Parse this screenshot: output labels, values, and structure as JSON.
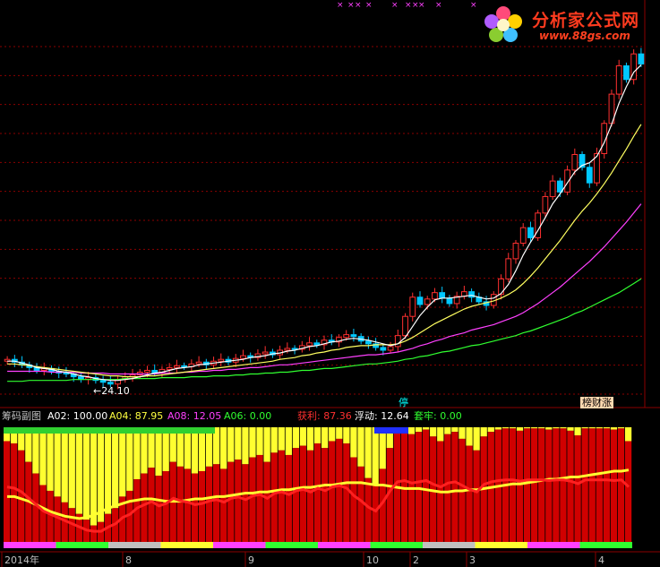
{
  "logo": {
    "title": "分析家公式网",
    "url": "www.88gs.com"
  },
  "tags": {
    "stop": "停",
    "rank": "榜财涨"
  },
  "price_low_label": "←24.10",
  "indicator": {
    "name": "筹码副图",
    "a02": "A02: 100.00",
    "a04": "A04: 87.95",
    "a08": "A08: 12.05",
    "a06": "A06: 0.00",
    "profit": "获利: 87.36",
    "float": "浮动: 12.64",
    "trapped": "套牢: 0.00"
  },
  "time_axis": [
    "2014年",
    "8",
    "9",
    "10",
    "2",
    "3",
    "4"
  ],
  "colors": {
    "background": "#000000",
    "grid": "#8b0000",
    "up": "#ff3030",
    "down": "#00c8ff",
    "ma_short": "#ffffff",
    "ma_mid": "#ffff60",
    "ma_long": "#ff40ff",
    "ma_longest": "#30ff30",
    "profit_bar": "#ffff30",
    "trapped_bar": "#d00000"
  },
  "chart_data": [
    {
      "type": "candlestick",
      "title": "",
      "low_marker": 24.1,
      "close": [
        26.8,
        26.5,
        26.2,
        25.9,
        25.6,
        25.8,
        25.5,
        25.3,
        25.2,
        24.9,
        24.6,
        24.8,
        24.5,
        24.3,
        24.1,
        24.6,
        24.9,
        25.1,
        25.4,
        25.6,
        25.3,
        25.7,
        25.9,
        26.1,
        26.0,
        26.3,
        26.5,
        26.2,
        26.6,
        26.8,
        26.5,
        26.9,
        27.2,
        27.0,
        27.4,
        27.6,
        27.3,
        27.8,
        28.0,
        27.9,
        28.3,
        28.6,
        28.4,
        28.9,
        28.7,
        29.2,
        29.5,
        29.3,
        28.8,
        28.5,
        28.1,
        27.8,
        28.2,
        29.4,
        31.5,
        33.6,
        32.8,
        33.4,
        34.1,
        33.5,
        32.9,
        33.7,
        34.2,
        33.6,
        33.1,
        32.7,
        33.9,
        35.6,
        37.8,
        39.5,
        41.2,
        40.1,
        42.8,
        44.6,
        46.3,
        45.1,
        47.5,
        49.2,
        47.8,
        46.1,
        49.3,
        52.6,
        55.8,
        58.9,
        57.4,
        60.2,
        59.1
      ],
      "ma_short": [
        26.6,
        26.6,
        26.4,
        26.2,
        25.9,
        25.8,
        25.7,
        25.5,
        25.4,
        25.2,
        25.0,
        24.9,
        24.7,
        24.6,
        24.5,
        24.5,
        24.6,
        24.7,
        24.9,
        25.1,
        25.3,
        25.4,
        25.6,
        25.8,
        25.9,
        26.0,
        26.2,
        26.3,
        26.4,
        26.5,
        26.6,
        26.7,
        26.8,
        27.0,
        27.1,
        27.2,
        27.4,
        27.5,
        27.7,
        27.8,
        28.0,
        28.2,
        28.3,
        28.5,
        28.7,
        28.8,
        29.0,
        29.1,
        29.0,
        28.9,
        28.7,
        28.5,
        28.3,
        28.5,
        29.2,
        30.4,
        31.6,
        32.5,
        33.3,
        33.5,
        33.5,
        33.6,
        33.7,
        33.8,
        33.6,
        33.4,
        33.5,
        34.0,
        35.0,
        36.5,
        38.2,
        39.6,
        40.9,
        42.3,
        43.8,
        44.9,
        46.1,
        47.3,
        48.0,
        48.3,
        49.0,
        50.5,
        52.5,
        54.8,
        56.6,
        58.2,
        59.0
      ],
      "ma_mid": [
        26.3,
        26.3,
        26.2,
        26.1,
        26.0,
        25.9,
        25.8,
        25.7,
        25.6,
        25.5,
        25.4,
        25.3,
        25.2,
        25.1,
        25.0,
        25.0,
        24.9,
        24.9,
        24.9,
        25.0,
        25.0,
        25.1,
        25.2,
        25.3,
        25.4,
        25.5,
        25.6,
        25.7,
        25.8,
        25.9,
        26.0,
        26.1,
        26.2,
        26.3,
        26.4,
        26.5,
        26.6,
        26.8,
        26.9,
        27.0,
        27.2,
        27.3,
        27.5,
        27.6,
        27.8,
        27.9,
        28.1,
        28.2,
        28.3,
        28.3,
        28.4,
        28.4,
        28.4,
        28.5,
        28.8,
        29.2,
        29.7,
        30.2,
        30.7,
        31.1,
        31.5,
        31.9,
        32.3,
        32.6,
        32.8,
        33.0,
        33.2,
        33.5,
        33.9,
        34.4,
        35.1,
        35.9,
        36.8,
        37.8,
        38.8,
        39.8,
        40.9,
        42.0,
        43.0,
        43.9,
        44.9,
        46.0,
        47.2,
        48.5,
        49.8,
        51.2,
        52.5
      ],
      "ma_long": [
        25.5,
        25.5,
        25.5,
        25.5,
        25.5,
        25.5,
        25.4,
        25.4,
        25.4,
        25.4,
        25.3,
        25.3,
        25.3,
        25.3,
        25.2,
        25.2,
        25.2,
        25.2,
        25.2,
        25.2,
        25.2,
        25.3,
        25.3,
        25.3,
        25.4,
        25.4,
        25.5,
        25.5,
        25.6,
        25.6,
        25.7,
        25.7,
        25.8,
        25.9,
        25.9,
        26.0,
        26.1,
        26.2,
        26.2,
        26.3,
        26.4,
        26.5,
        26.6,
        26.7,
        26.8,
        26.9,
        27.0,
        27.1,
        27.2,
        27.3,
        27.3,
        27.4,
        27.5,
        27.6,
        27.8,
        28.0,
        28.3,
        28.5,
        28.8,
        29.0,
        29.3,
        29.5,
        29.7,
        30.0,
        30.2,
        30.4,
        30.6,
        30.9,
        31.2,
        31.5,
        31.9,
        32.4,
        32.9,
        33.5,
        34.1,
        34.7,
        35.4,
        36.1,
        36.8,
        37.5,
        38.3,
        39.1,
        40.0,
        40.9,
        41.8,
        42.8,
        43.8
      ],
      "ma_longest": [
        24.4,
        24.4,
        24.4,
        24.5,
        24.5,
        24.5,
        24.5,
        24.5,
        24.5,
        24.6,
        24.6,
        24.6,
        24.6,
        24.6,
        24.6,
        24.6,
        24.7,
        24.7,
        24.7,
        24.7,
        24.7,
        24.8,
        24.8,
        24.8,
        24.8,
        24.9,
        24.9,
        24.9,
        25.0,
        25.0,
        25.0,
        25.1,
        25.1,
        25.2,
        25.2,
        25.3,
        25.3,
        25.4,
        25.4,
        25.5,
        25.6,
        25.6,
        25.7,
        25.8,
        25.8,
        25.9,
        26.0,
        26.1,
        26.2,
        26.3,
        26.3,
        26.4,
        26.5,
        26.6,
        26.8,
        26.9,
        27.1,
        27.2,
        27.4,
        27.6,
        27.7,
        27.9,
        28.1,
        28.3,
        28.4,
        28.6,
        28.8,
        29.0,
        29.2,
        29.4,
        29.7,
        29.9,
        30.2,
        30.5,
        30.8,
        31.1,
        31.4,
        31.8,
        32.1,
        32.5,
        32.9,
        33.3,
        33.7,
        34.1,
        34.6,
        35.1,
        35.6
      ],
      "ylim": [
        23,
        61
      ]
    },
    {
      "type": "bar",
      "title": "",
      "profit_pct": [
        88,
        86,
        80,
        70,
        60,
        50,
        45,
        40,
        35,
        30,
        25,
        20,
        15,
        18,
        25,
        30,
        40,
        45,
        55,
        60,
        65,
        58,
        62,
        70,
        66,
        64,
        60,
        62,
        66,
        68,
        64,
        70,
        72,
        68,
        74,
        76,
        70,
        78,
        80,
        76,
        82,
        84,
        80,
        86,
        82,
        88,
        90,
        86,
        74,
        66,
        56,
        50,
        64,
        82,
        96,
        98,
        94,
        96,
        98,
        92,
        88,
        94,
        96,
        90,
        84,
        80,
        92,
        96,
        98,
        99,
        99,
        97,
        99,
        99,
        99,
        98,
        99,
        99,
        97,
        93,
        99,
        99,
        99,
        99,
        98,
        99,
        88
      ],
      "avg_cost_line": [
        40,
        40,
        38,
        36,
        33,
        30,
        27,
        25,
        23,
        22,
        21,
        22,
        24,
        27,
        30,
        32,
        34,
        36,
        37,
        38,
        38,
        37,
        36,
        36,
        36,
        37,
        38,
        38,
        39,
        40,
        40,
        41,
        42,
        43,
        43,
        44,
        44,
        45,
        46,
        46,
        47,
        48,
        48,
        49,
        50,
        50,
        51,
        52,
        52,
        52,
        51,
        50,
        50,
        49,
        48,
        47,
        47,
        47,
        46,
        45,
        44,
        44,
        45,
        45,
        46,
        46,
        47,
        48,
        49,
        50,
        51,
        51,
        52,
        53,
        54,
        55,
        55,
        56,
        57,
        57,
        58,
        59,
        60,
        61,
        62,
        62,
        63
      ],
      "ylim": [
        0,
        100
      ]
    }
  ]
}
